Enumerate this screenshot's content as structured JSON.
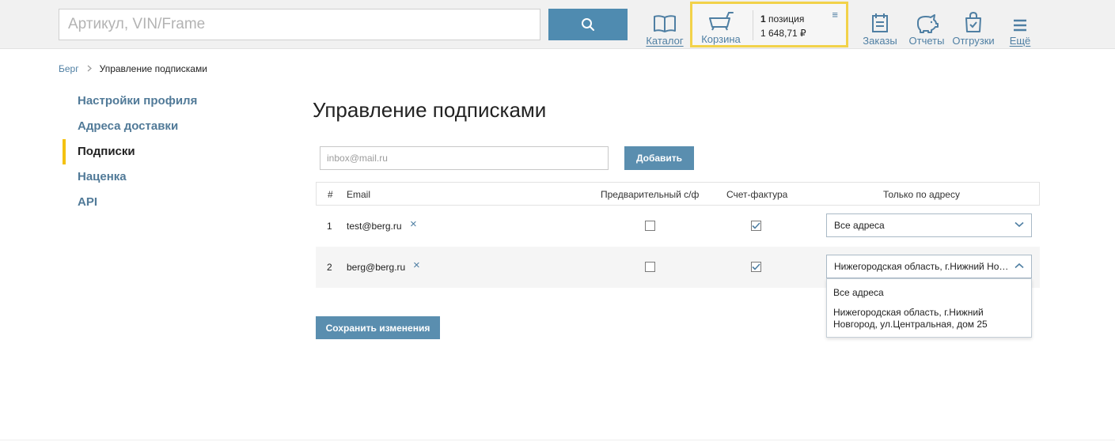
{
  "header": {
    "search_placeholder": "Артикул, VIN/Frame",
    "catalog_label": "Каталог",
    "cart": {
      "label": "Корзина",
      "count_number": "1",
      "count_word": " позиция",
      "sum": "1 648,71 ₽",
      "menu_icon": "≡"
    },
    "orders_label": "Заказы",
    "reports_label": "Отчеты",
    "shipments_label": "Отгрузки",
    "more_label": "Ещё",
    "accent_color": "#4f8bb0",
    "cart_border_color": "#f2d24a"
  },
  "breadcrumb": {
    "root": "Берг",
    "separator": ">",
    "current": "Управление подписками"
  },
  "sidebar": {
    "items": [
      {
        "label": "Настройки профиля",
        "active": false
      },
      {
        "label": "Адреса доставки",
        "active": false
      },
      {
        "label": "Подписки",
        "active": true
      },
      {
        "label": "Наценка",
        "active": false
      },
      {
        "label": "API",
        "active": false
      }
    ],
    "active_color": "#f4c211"
  },
  "main": {
    "title": "Управление подписками",
    "email_placeholder": "inbox@mail.ru",
    "add_button": "Добавить",
    "save_button": "Сохранить изменения",
    "table": {
      "headers": {
        "num": "#",
        "email": "Email",
        "preliminary": "Предварительный с/ф",
        "invoice": "Счет-фактура",
        "address": "Только по адресу"
      },
      "rows": [
        {
          "num": "1",
          "email": "test@berg.ru",
          "preliminary": false,
          "invoice": true,
          "address": "Все адреса",
          "open": false
        },
        {
          "num": "2",
          "email": "berg@berg.ru",
          "preliminary": false,
          "invoice": true,
          "address": "Нижегородская область, г.Нижний Новгород, ул.Центральная, дом 25",
          "open": true
        }
      ],
      "remove_icon": "×"
    },
    "dropdown_options": [
      "Все адреса",
      "Нижегородская область, г.Нижний Новгород, ул.Центральная, дом 25"
    ]
  }
}
